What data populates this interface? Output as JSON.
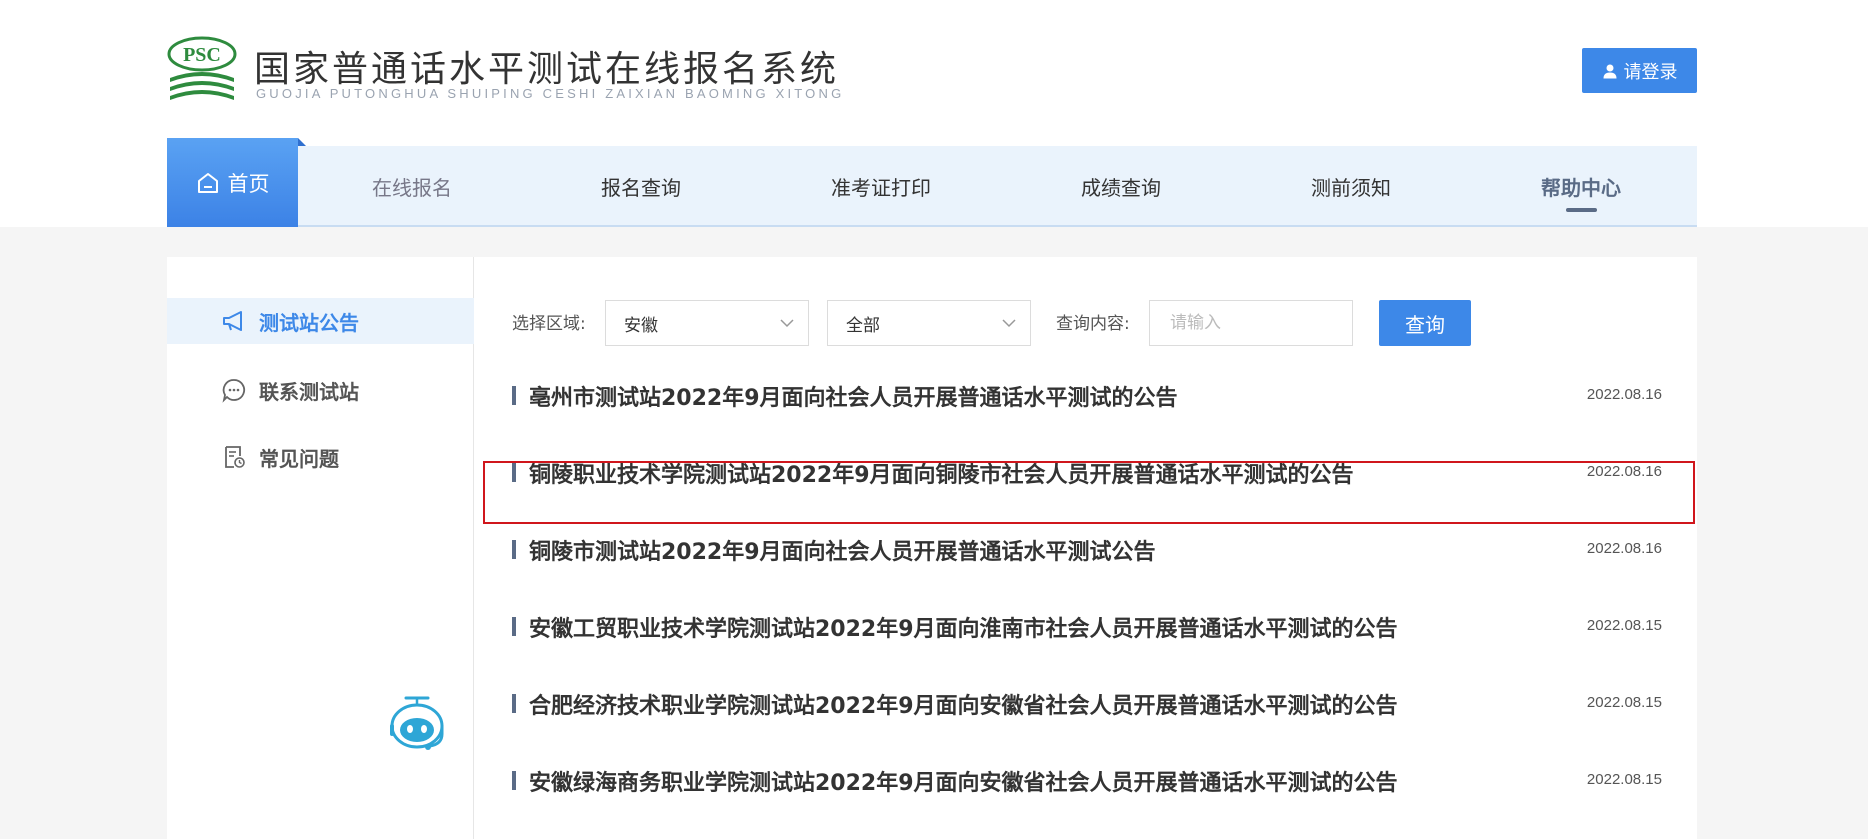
{
  "header": {
    "logo_mark_text": "PSC",
    "title_cn": "国家普通话水平测试在线报名系统",
    "title_en": "GUOJIA PUTONGHUA SHUIPING CESHI ZAIXIAN BAOMING XITONG",
    "login_label": "请登录"
  },
  "nav": {
    "home": "首页",
    "items": [
      "在线报名",
      "报名查询",
      "准考证打印",
      "成绩查询",
      "测前须知",
      "帮助中心"
    ]
  },
  "sidebar": {
    "items": [
      {
        "label": "测试站公告",
        "icon": "megaphone-icon",
        "active": true
      },
      {
        "label": "联系测试站",
        "icon": "chat-bubble-icon",
        "active": false
      },
      {
        "label": "常见问题",
        "icon": "document-clock-icon",
        "active": false
      }
    ]
  },
  "filter": {
    "region_label": "选择区域:",
    "region_value": "安徽",
    "sub_value": "全部",
    "query_label": "查询内容:",
    "query_placeholder": "请输入",
    "query_button": "查询"
  },
  "announcements": [
    {
      "title": "亳州市测试站2022年9月面向社会人员开展普通话水平测试的公告",
      "date": "2022.08.16"
    },
    {
      "title": "铜陵职业技术学院测试站2022年9月面向铜陵市社会人员开展普通话水平测试的公告",
      "date": "2022.08.16"
    },
    {
      "title": "铜陵市测试站2022年9月面向社会人员开展普通话水平测试公告",
      "date": "2022.08.16"
    },
    {
      "title": "安徽工贸职业技术学院测试站2022年9月面向淮南市社会人员开展普通话水平测试的公告",
      "date": "2022.08.15"
    },
    {
      "title": "合肥经济技术职业学院测试站2022年9月面向安徽省社会人员开展普通话水平测试的公告",
      "date": "2022.08.15"
    },
    {
      "title": "安徽绿海商务职业学院测试站2022年9月面向安徽省社会人员开展普通话水平测试的公告",
      "date": "2022.08.15"
    }
  ],
  "colors": {
    "accent": "#3d88e8",
    "highlight": "#d0161c",
    "nav_bg": "#eaf3fc"
  }
}
